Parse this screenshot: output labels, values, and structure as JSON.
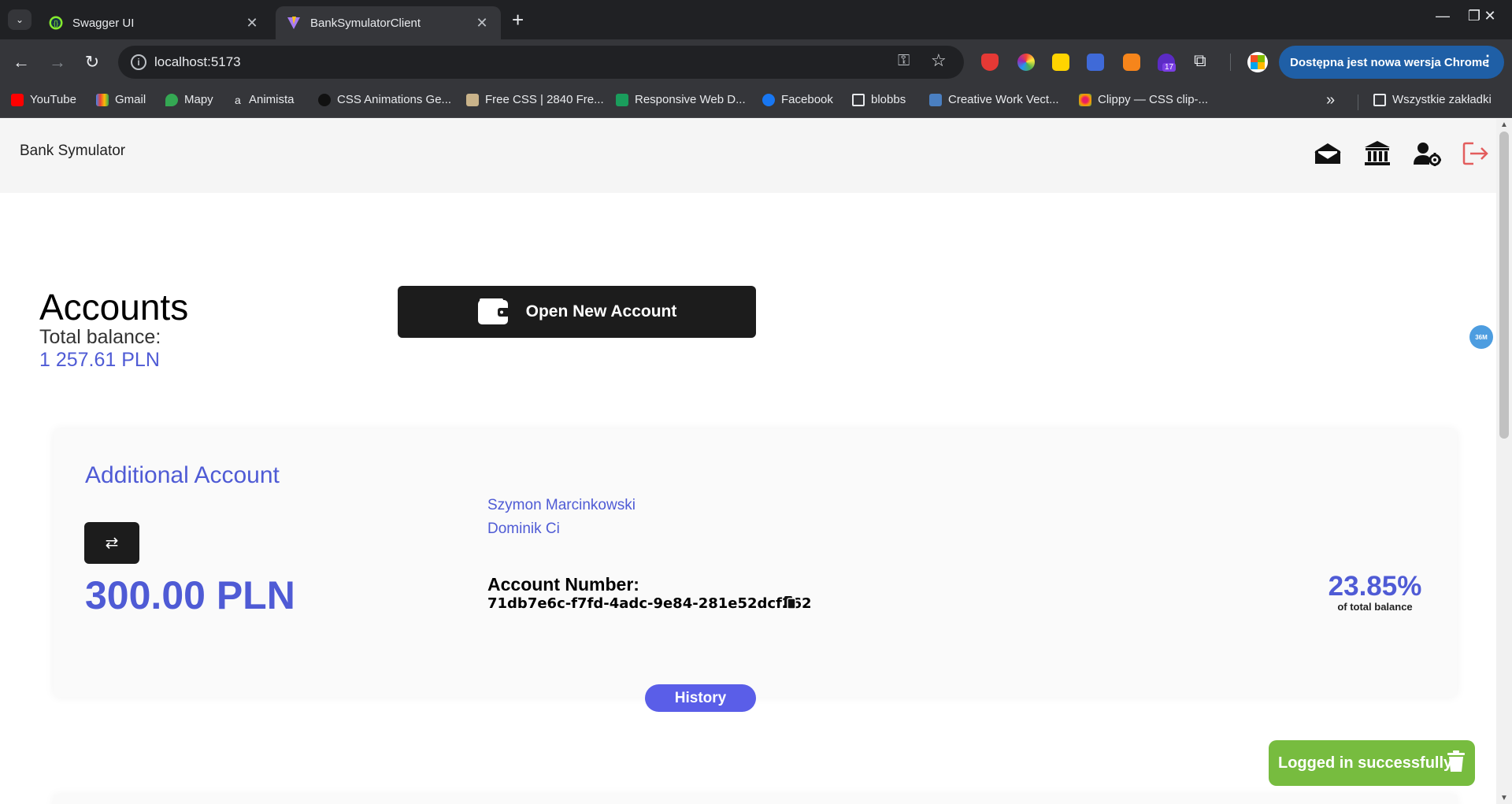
{
  "browser": {
    "tabs": [
      {
        "title": "Swagger UI",
        "active": false
      },
      {
        "title": "BankSymulatorClient",
        "active": true
      }
    ],
    "address": "localhost:5173",
    "update_notice": "Dostępna jest nowa wersja Chrome",
    "extension_badge": "17",
    "bookmarks": [
      "YouTube",
      "Gmail",
      "Mapy",
      "Animista",
      "CSS Animations Ge...",
      "Free CSS | 2840 Fre...",
      "Responsive Web D...",
      "Facebook",
      "blobbs",
      "Creative Work Vect...",
      "Clippy — CSS clip-..."
    ],
    "all_bookmarks": "Wszystkie zakładki"
  },
  "app": {
    "brand": "Bank Symulator",
    "nav_icons": [
      "envelope-open-icon",
      "bank-icon",
      "user-settings-icon",
      "logout-icon"
    ]
  },
  "accounts": {
    "title": "Accounts",
    "total_label": "Total balance:",
    "total_value": "1 257.61 PLN",
    "open_button": "Open New Account"
  },
  "floating_badge": "36M",
  "account_card": {
    "name": "Additional Account",
    "balance": "300.00 PLN",
    "owners": [
      "Szymon Marcinkowski",
      "Dominik Ci"
    ],
    "number_label": "Account Number:",
    "number": "71db7e6c-f7fd-4adc-9e84-281e52dcf262",
    "percent": "23.85%",
    "percent_label": "of total balance",
    "history_button": "History"
  },
  "toast": {
    "message": "Logged in successfully"
  },
  "colors": {
    "accent": "#4f5bd5",
    "toast": "#77bc3f",
    "dark_button": "#1c1c1c",
    "logout": "#e35d5d"
  }
}
